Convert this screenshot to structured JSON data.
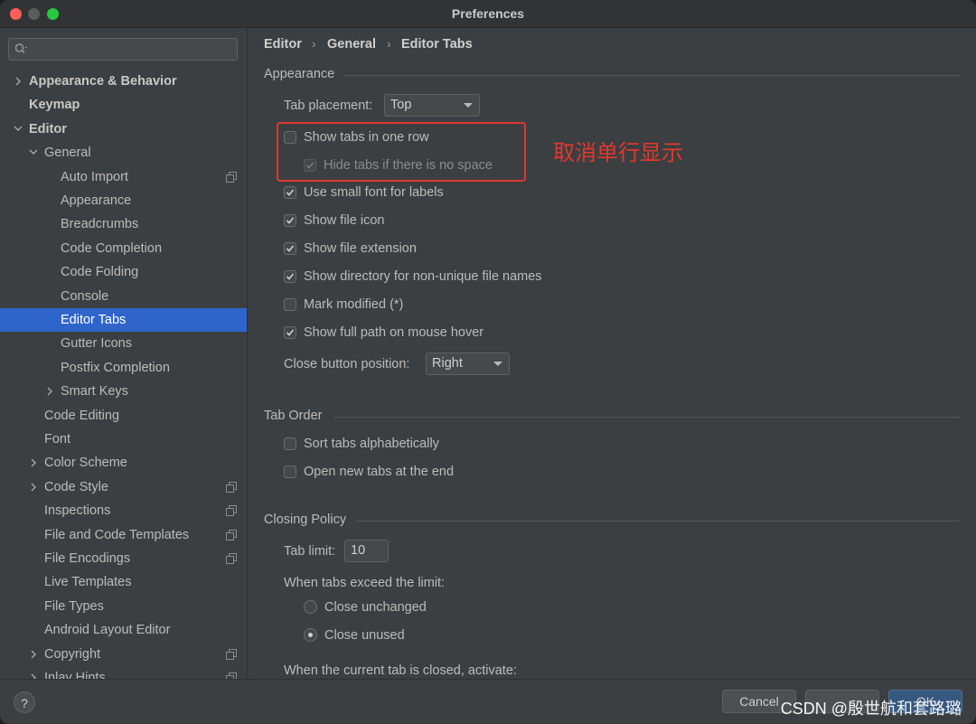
{
  "window": {
    "title": "Preferences"
  },
  "sidebar": {
    "search_placeholder": "",
    "items": [
      {
        "label": "Appearance & Behavior",
        "bold": true,
        "arrow": "right",
        "indent": 0
      },
      {
        "label": "Keymap",
        "bold": true,
        "arrow": "",
        "indent": 0
      },
      {
        "label": "Editor",
        "bold": true,
        "arrow": "down",
        "indent": 0
      },
      {
        "label": "General",
        "bold": false,
        "arrow": "down",
        "indent": 1
      },
      {
        "label": "Auto Import",
        "bold": false,
        "arrow": "",
        "indent": 2,
        "copy": true
      },
      {
        "label": "Appearance",
        "bold": false,
        "arrow": "",
        "indent": 2
      },
      {
        "label": "Breadcrumbs",
        "bold": false,
        "arrow": "",
        "indent": 2
      },
      {
        "label": "Code Completion",
        "bold": false,
        "arrow": "",
        "indent": 2
      },
      {
        "label": "Code Folding",
        "bold": false,
        "arrow": "",
        "indent": 2
      },
      {
        "label": "Console",
        "bold": false,
        "arrow": "",
        "indent": 2
      },
      {
        "label": "Editor Tabs",
        "bold": false,
        "arrow": "",
        "indent": 2,
        "selected": true
      },
      {
        "label": "Gutter Icons",
        "bold": false,
        "arrow": "",
        "indent": 2
      },
      {
        "label": "Postfix Completion",
        "bold": false,
        "arrow": "",
        "indent": 2
      },
      {
        "label": "Smart Keys",
        "bold": false,
        "arrow": "right",
        "indent": 2
      },
      {
        "label": "Code Editing",
        "bold": false,
        "arrow": "",
        "indent": 1
      },
      {
        "label": "Font",
        "bold": false,
        "arrow": "",
        "indent": 1
      },
      {
        "label": "Color Scheme",
        "bold": false,
        "arrow": "right",
        "indent": 1
      },
      {
        "label": "Code Style",
        "bold": false,
        "arrow": "right",
        "indent": 1,
        "copy": true
      },
      {
        "label": "Inspections",
        "bold": false,
        "arrow": "",
        "indent": 1,
        "copy": true
      },
      {
        "label": "File and Code Templates",
        "bold": false,
        "arrow": "",
        "indent": 1,
        "copy": true
      },
      {
        "label": "File Encodings",
        "bold": false,
        "arrow": "",
        "indent": 1,
        "copy": true
      },
      {
        "label": "Live Templates",
        "bold": false,
        "arrow": "",
        "indent": 1
      },
      {
        "label": "File Types",
        "bold": false,
        "arrow": "",
        "indent": 1
      },
      {
        "label": "Android Layout Editor",
        "bold": false,
        "arrow": "",
        "indent": 1
      },
      {
        "label": "Copyright",
        "bold": false,
        "arrow": "right",
        "indent": 1,
        "copy": true
      },
      {
        "label": "Inlay Hints",
        "bold": false,
        "arrow": "right",
        "indent": 1,
        "copy": true
      }
    ]
  },
  "breadcrumb": {
    "items": [
      "Editor",
      "General",
      "Editor Tabs"
    ],
    "separator": "›"
  },
  "appearance": {
    "heading": "Appearance",
    "tab_placement_label": "Tab placement:",
    "tab_placement_value": "Top",
    "show_tabs_one_row": {
      "label": "Show tabs in one row",
      "checked": false
    },
    "hide_tabs_no_space": {
      "label": "Hide tabs if there is no space",
      "checked": true,
      "disabled": true
    },
    "small_font": {
      "label": "Use small font for labels",
      "checked": true
    },
    "show_file_icon": {
      "label": "Show file icon",
      "checked": true
    },
    "show_file_ext": {
      "label": "Show file extension",
      "checked": true
    },
    "show_dir": {
      "label": "Show directory for non-unique file names",
      "checked": true
    },
    "mark_modified": {
      "label": "Mark modified (*)",
      "checked": false
    },
    "full_path": {
      "label": "Show full path on mouse hover",
      "checked": true
    },
    "close_btn_label": "Close button position:",
    "close_btn_value": "Right"
  },
  "annotation": {
    "text": "取消单行显示",
    "color": "#e2382e"
  },
  "tab_order": {
    "heading": "Tab Order",
    "sort_alpha": {
      "label": "Sort tabs alphabetically",
      "checked": false
    },
    "open_at_end": {
      "label": "Open new tabs at the end",
      "checked": false
    }
  },
  "closing_policy": {
    "heading": "Closing Policy",
    "tab_limit_label": "Tab limit:",
    "tab_limit_value": "10",
    "exceed_label": "When tabs exceed the limit:",
    "close_unchanged": {
      "label": "Close unchanged",
      "selected": false
    },
    "close_unused": {
      "label": "Close unused",
      "selected": true
    },
    "closed_activate_label": "When the current tab is closed, activate:"
  },
  "footer": {
    "help_label": "?",
    "cancel_label": "Cancel",
    "ok_label": "OK",
    "watermark": "CSDN @殷世航和套路璐"
  },
  "colors": {
    "selection": "#2f65ca",
    "accent_red": "#e2382e",
    "background": "#3c3f41"
  }
}
